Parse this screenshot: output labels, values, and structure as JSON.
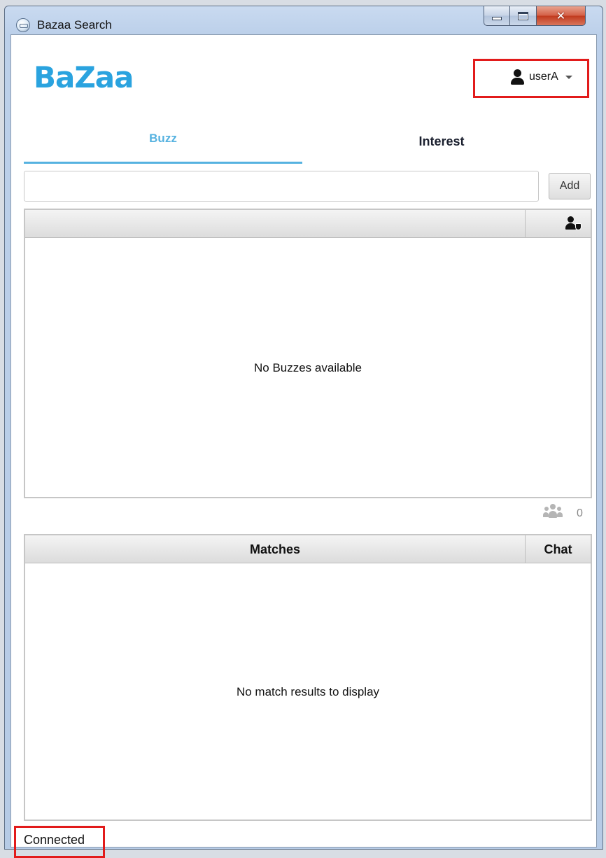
{
  "window": {
    "title": "Bazaa Search",
    "close_glyph": "✕"
  },
  "header": {
    "logo_text": "BaZaa",
    "user_name": "userA"
  },
  "tabs": [
    {
      "label": "Buzz",
      "active": true
    },
    {
      "label": "Interest",
      "active": false
    }
  ],
  "buzz_entry": {
    "input_value": "",
    "add_label": "Add"
  },
  "buzz_table": {
    "empty_message": "No Buzzes available"
  },
  "group_count": {
    "value": "0"
  },
  "matches_table": {
    "columns": [
      "Matches",
      "Chat"
    ],
    "empty_message": "No match results to display"
  },
  "status": {
    "text": "Connected"
  },
  "colors": {
    "brand": "#2aa3df",
    "active_tab": "#56b2e0",
    "highlight": "#e21b1b"
  },
  "icons": {
    "app": "app-globe-icon",
    "user": "user-icon",
    "user_settings": "user-shield-icon",
    "group": "group-icon"
  }
}
